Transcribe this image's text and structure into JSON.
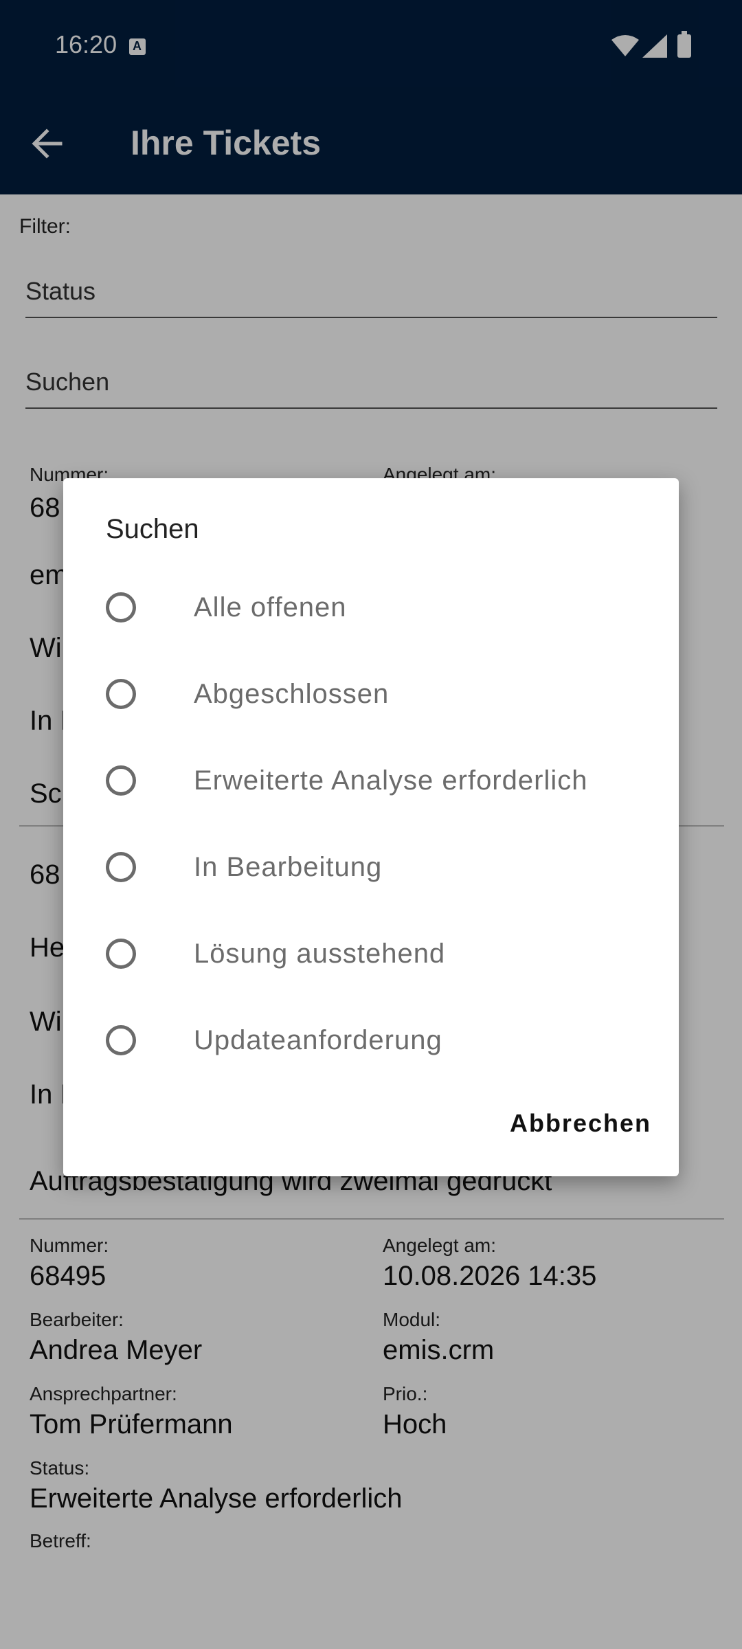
{
  "status_bar": {
    "time": "16:20"
  },
  "app_bar": {
    "title": "Ihre Tickets"
  },
  "filter": {
    "label": "Filter:",
    "status_placeholder": "Status",
    "search_placeholder": "Suchen"
  },
  "tickets": [
    {
      "labels": {
        "number": "Nummer:",
        "created": "Angelegt am:",
        "assignee": "Bearbeiter:",
        "module": "Modul:",
        "contact": "Ansprechpartner:",
        "prio": "Prio.:",
        "status": "Status:",
        "subject": "Betreff:"
      },
      "number": "68",
      "assignee": "em",
      "contact": "Wi",
      "status": "In I",
      "subject": "Sc"
    },
    {
      "number": "68",
      "assignee": "He",
      "contact": "Wi",
      "status": "In I",
      "subject": "Auftragsbestätigung wird zweimal gedruckt"
    },
    {
      "number": "68495",
      "created": "10.08.2026 14:35",
      "assignee": "Andrea Meyer",
      "module": "emis.crm",
      "contact": "Tom Prüfermann",
      "prio": "Hoch",
      "status": "Erweiterte Analyse erforderlich"
    }
  ],
  "dialog": {
    "title": "Suchen",
    "options": [
      "Alle offenen",
      "Abgeschlossen",
      "Erweiterte Analyse erforderlich",
      "In Bearbeitung",
      "Lösung ausstehend",
      "Updateanforderung"
    ],
    "cancel_label": "Abbrechen"
  },
  "colors": {
    "app_bar": "#021e3f",
    "scrim": "rgba(0,0,0,0.32)"
  }
}
